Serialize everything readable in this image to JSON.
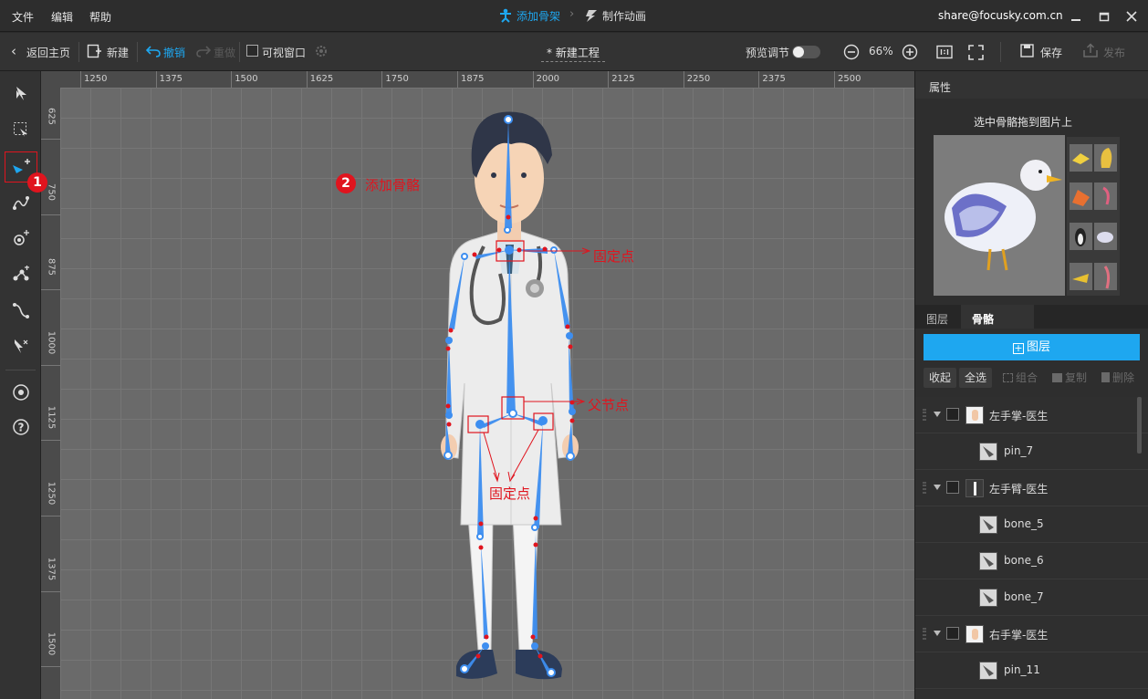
{
  "menubar": {
    "items": [
      "文件",
      "编辑",
      "帮助"
    ],
    "step_tabs": [
      "添加骨架",
      "制作动画"
    ],
    "account_email": "share@focusky.com.cn"
  },
  "toolbar": {
    "back_label": "返回主页",
    "new_label": "新建",
    "undo_label": "撤销",
    "redo_label": "重做",
    "visible_window_label": "可视窗口",
    "project_title": "* 新建工程",
    "preview_adjust_label": "预览调节",
    "zoom_level": "66%",
    "save_label": "保存",
    "publish_label": "发布"
  },
  "ruler": {
    "top_ticks": [
      "1250",
      "1375",
      "1500",
      "1625",
      "1750",
      "1875",
      "2000",
      "2125",
      "2250",
      "2375",
      "2500"
    ],
    "left_ticks": [
      "625",
      "750",
      "875",
      "1000",
      "1125",
      "1250",
      "1375",
      "1500"
    ]
  },
  "canvas": {
    "annotations": {
      "step1_number": "1",
      "step2_number": "2",
      "add_bone_label": "添加骨骼",
      "fixed_point_label": "固定点",
      "parent_node_label": "父节点",
      "fixed_point_bottom_label": "固定点"
    }
  },
  "properties": {
    "header": "属性",
    "hint": "选中骨骼拖到图片上"
  },
  "layers_panel": {
    "tabs": [
      "图层",
      "骨骼"
    ],
    "add_layer_label": "图层",
    "actions": [
      "收起",
      "全选",
      "组合",
      "复制",
      "删除"
    ],
    "rows": [
      {
        "label": "左手掌-医生",
        "type": "layer"
      },
      {
        "label": "pin_7",
        "type": "bone"
      },
      {
        "label": "左手臂-医生",
        "type": "layer"
      },
      {
        "label": "bone_5",
        "type": "bone"
      },
      {
        "label": "bone_6",
        "type": "bone"
      },
      {
        "label": "bone_7",
        "type": "bone"
      },
      {
        "label": "右手掌-医生",
        "type": "layer"
      },
      {
        "label": "pin_11",
        "type": "bone"
      }
    ]
  },
  "colors": {
    "accent_blue": "#1ea7f0",
    "annotation_red": "#e0141e",
    "bone_blue": "#3d8ef0"
  }
}
